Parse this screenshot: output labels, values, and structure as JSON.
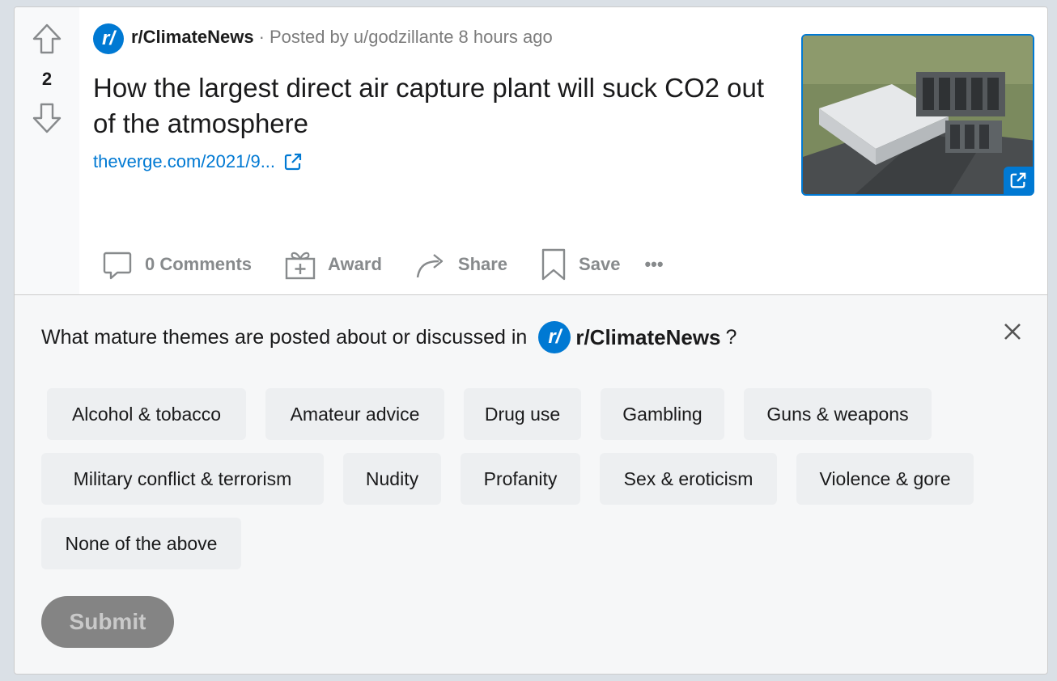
{
  "post": {
    "votes": "2",
    "subreddit_icon": "r/",
    "subreddit": "r/ClimateNews",
    "separator": "·",
    "posted_by": "Posted by u/godzillante 8 hours ago",
    "title": "How the largest direct air capture plant will suck CO2 out of the atmosphere",
    "link_text": "theverge.com/2021/9...",
    "icons": [
      "upvote-icon",
      "downvote-icon",
      "external-link-icon",
      "comment-icon",
      "gift-icon",
      "share-arrow-icon",
      "bookmark-icon",
      "more-dots-icon"
    ],
    "actions": {
      "comments": "0 Comments",
      "award": "Award",
      "share": "Share",
      "save": "Save",
      "more": "•••"
    }
  },
  "survey": {
    "question_prefix": "What mature themes are posted about or discussed in",
    "sub_icon": "r/",
    "subreddit": "r/ClimateNews",
    "question_suffix": "?",
    "options": [
      "Alcohol & tobacco",
      "Amateur advice",
      "Drug use",
      "Gambling",
      "Guns & weapons",
      "Military conflict & terrorism",
      "Nudity",
      "Profanity",
      "Sex & eroticism",
      "Violence & gore",
      "None of the above"
    ],
    "submit_label": "Submit"
  },
  "colors": {
    "accent": "#0079d3",
    "chip_bg": "#edeff1",
    "submit_disabled": "#848484"
  }
}
